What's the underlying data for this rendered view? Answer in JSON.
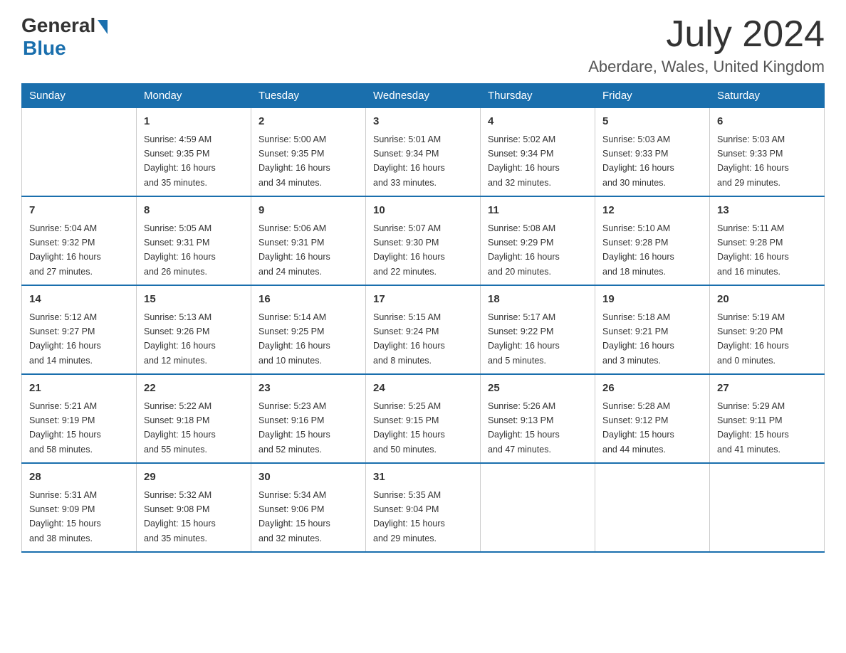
{
  "logo": {
    "general": "General",
    "blue": "Blue"
  },
  "title": "July 2024",
  "location": "Aberdare, Wales, United Kingdom",
  "days_of_week": [
    "Sunday",
    "Monday",
    "Tuesday",
    "Wednesday",
    "Thursday",
    "Friday",
    "Saturday"
  ],
  "weeks": [
    [
      {
        "day": "",
        "info": ""
      },
      {
        "day": "1",
        "info": "Sunrise: 4:59 AM\nSunset: 9:35 PM\nDaylight: 16 hours\nand 35 minutes."
      },
      {
        "day": "2",
        "info": "Sunrise: 5:00 AM\nSunset: 9:35 PM\nDaylight: 16 hours\nand 34 minutes."
      },
      {
        "day": "3",
        "info": "Sunrise: 5:01 AM\nSunset: 9:34 PM\nDaylight: 16 hours\nand 33 minutes."
      },
      {
        "day": "4",
        "info": "Sunrise: 5:02 AM\nSunset: 9:34 PM\nDaylight: 16 hours\nand 32 minutes."
      },
      {
        "day": "5",
        "info": "Sunrise: 5:03 AM\nSunset: 9:33 PM\nDaylight: 16 hours\nand 30 minutes."
      },
      {
        "day": "6",
        "info": "Sunrise: 5:03 AM\nSunset: 9:33 PM\nDaylight: 16 hours\nand 29 minutes."
      }
    ],
    [
      {
        "day": "7",
        "info": "Sunrise: 5:04 AM\nSunset: 9:32 PM\nDaylight: 16 hours\nand 27 minutes."
      },
      {
        "day": "8",
        "info": "Sunrise: 5:05 AM\nSunset: 9:31 PM\nDaylight: 16 hours\nand 26 minutes."
      },
      {
        "day": "9",
        "info": "Sunrise: 5:06 AM\nSunset: 9:31 PM\nDaylight: 16 hours\nand 24 minutes."
      },
      {
        "day": "10",
        "info": "Sunrise: 5:07 AM\nSunset: 9:30 PM\nDaylight: 16 hours\nand 22 minutes."
      },
      {
        "day": "11",
        "info": "Sunrise: 5:08 AM\nSunset: 9:29 PM\nDaylight: 16 hours\nand 20 minutes."
      },
      {
        "day": "12",
        "info": "Sunrise: 5:10 AM\nSunset: 9:28 PM\nDaylight: 16 hours\nand 18 minutes."
      },
      {
        "day": "13",
        "info": "Sunrise: 5:11 AM\nSunset: 9:28 PM\nDaylight: 16 hours\nand 16 minutes."
      }
    ],
    [
      {
        "day": "14",
        "info": "Sunrise: 5:12 AM\nSunset: 9:27 PM\nDaylight: 16 hours\nand 14 minutes."
      },
      {
        "day": "15",
        "info": "Sunrise: 5:13 AM\nSunset: 9:26 PM\nDaylight: 16 hours\nand 12 minutes."
      },
      {
        "day": "16",
        "info": "Sunrise: 5:14 AM\nSunset: 9:25 PM\nDaylight: 16 hours\nand 10 minutes."
      },
      {
        "day": "17",
        "info": "Sunrise: 5:15 AM\nSunset: 9:24 PM\nDaylight: 16 hours\nand 8 minutes."
      },
      {
        "day": "18",
        "info": "Sunrise: 5:17 AM\nSunset: 9:22 PM\nDaylight: 16 hours\nand 5 minutes."
      },
      {
        "day": "19",
        "info": "Sunrise: 5:18 AM\nSunset: 9:21 PM\nDaylight: 16 hours\nand 3 minutes."
      },
      {
        "day": "20",
        "info": "Sunrise: 5:19 AM\nSunset: 9:20 PM\nDaylight: 16 hours\nand 0 minutes."
      }
    ],
    [
      {
        "day": "21",
        "info": "Sunrise: 5:21 AM\nSunset: 9:19 PM\nDaylight: 15 hours\nand 58 minutes."
      },
      {
        "day": "22",
        "info": "Sunrise: 5:22 AM\nSunset: 9:18 PM\nDaylight: 15 hours\nand 55 minutes."
      },
      {
        "day": "23",
        "info": "Sunrise: 5:23 AM\nSunset: 9:16 PM\nDaylight: 15 hours\nand 52 minutes."
      },
      {
        "day": "24",
        "info": "Sunrise: 5:25 AM\nSunset: 9:15 PM\nDaylight: 15 hours\nand 50 minutes."
      },
      {
        "day": "25",
        "info": "Sunrise: 5:26 AM\nSunset: 9:13 PM\nDaylight: 15 hours\nand 47 minutes."
      },
      {
        "day": "26",
        "info": "Sunrise: 5:28 AM\nSunset: 9:12 PM\nDaylight: 15 hours\nand 44 minutes."
      },
      {
        "day": "27",
        "info": "Sunrise: 5:29 AM\nSunset: 9:11 PM\nDaylight: 15 hours\nand 41 minutes."
      }
    ],
    [
      {
        "day": "28",
        "info": "Sunrise: 5:31 AM\nSunset: 9:09 PM\nDaylight: 15 hours\nand 38 minutes."
      },
      {
        "day": "29",
        "info": "Sunrise: 5:32 AM\nSunset: 9:08 PM\nDaylight: 15 hours\nand 35 minutes."
      },
      {
        "day": "30",
        "info": "Sunrise: 5:34 AM\nSunset: 9:06 PM\nDaylight: 15 hours\nand 32 minutes."
      },
      {
        "day": "31",
        "info": "Sunrise: 5:35 AM\nSunset: 9:04 PM\nDaylight: 15 hours\nand 29 minutes."
      },
      {
        "day": "",
        "info": ""
      },
      {
        "day": "",
        "info": ""
      },
      {
        "day": "",
        "info": ""
      }
    ]
  ]
}
